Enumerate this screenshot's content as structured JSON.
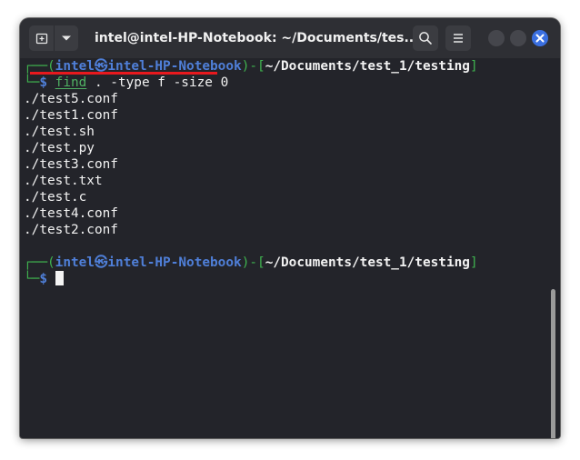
{
  "window": {
    "title": "intel@intel-HP-Notebook: ~/Documents/tes..."
  },
  "toolbar": {
    "new_tab_icon": "new-tab-icon",
    "menu_icon": "chevron-down-icon",
    "search_icon": "search-icon",
    "hamburger_icon": "hamburger-icon",
    "close_icon": "close-icon"
  },
  "terminal": {
    "prompt1": {
      "top_prefix": "┌──(",
      "user": "intel",
      "at_symbol": "㉿",
      "host": "intel-HP-Notebook",
      "mid": ")-[",
      "path": "~/Documents/test_1/testing",
      "close": "]",
      "bottom_prefix": "└─",
      "dollar": "$ ",
      "command": "find",
      "args": " . -type f -size 0"
    },
    "output": [
      "./test5.conf",
      "./test1.conf",
      "./test.sh",
      "./test.py",
      "./test3.conf",
      "./test.txt",
      "./test.c",
      "./test4.conf",
      "./test2.conf"
    ],
    "prompt2": {
      "top_prefix": "┌──(",
      "user": "intel",
      "at_symbol": "㉿",
      "host": "intel-HP-Notebook",
      "mid": ")-[",
      "path": "~/Documents/test_1/testing",
      "close": "]",
      "bottom_prefix": "└─",
      "dollar": "$ "
    }
  },
  "colors": {
    "prompt_frame": "#3fb34f",
    "prompt_user": "#4f7fd8",
    "command": "#4fb062",
    "annotation_underline": "#e8191e",
    "close_button": "#3a6fe0"
  }
}
